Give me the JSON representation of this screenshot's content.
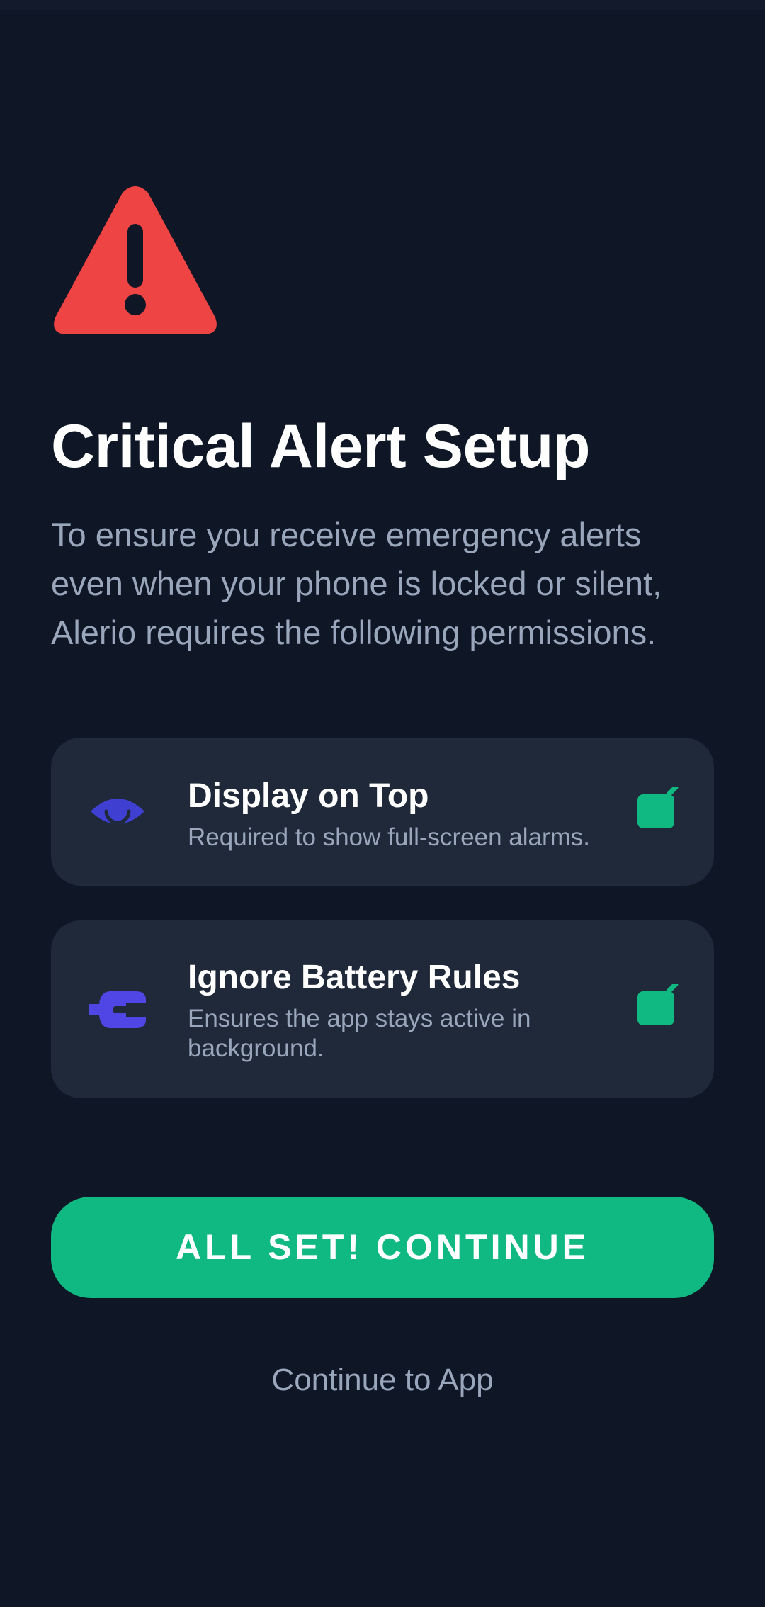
{
  "header": {
    "alert_icon": "warning-triangle-icon",
    "title": "Critical Alert Setup",
    "description": "To ensure you receive emergency alerts even when your phone is locked or silent, Alerio requires the following permissions."
  },
  "permissions": [
    {
      "icon": "eye-icon",
      "title": "Display on Top",
      "subtitle": "Required to show full-screen alarms.",
      "checked": true
    },
    {
      "icon": "battery-plug-icon",
      "title": "Ignore Battery Rules",
      "subtitle": "Ensures the app stays active in background.",
      "checked": true
    }
  ],
  "actions": {
    "primary_label": "ALL SET! CONTINUE",
    "secondary_label": "Continue to App"
  },
  "colors": {
    "background": "#0f1726",
    "card": "#1f2939",
    "accent_green": "#10b981",
    "alert_red": "#ef4444",
    "icon_indigo": "#3f3fd1",
    "muted_text": "#9aa6bb"
  }
}
